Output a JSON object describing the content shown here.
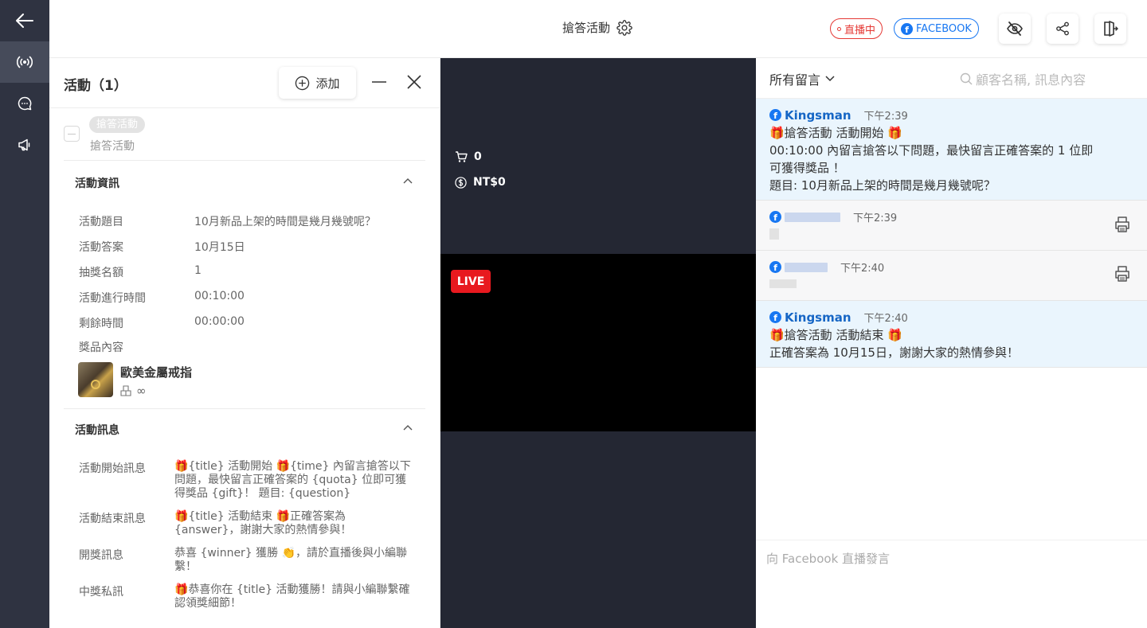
{
  "rail": {
    "items": [
      "back-icon",
      "broadcast-icon",
      "chat-icon",
      "megaphone-icon"
    ]
  },
  "topbar": {
    "title": "搶答活動",
    "live_status": "直播中",
    "platform": "FACEBOOK"
  },
  "panel": {
    "title": "活動（1）",
    "add_label": "添加",
    "activity": {
      "tag": "搶答活動",
      "name": "搶答活動"
    },
    "info_section": {
      "title": "活動資訊",
      "rows": [
        {
          "label": "活動題目",
          "value": "10月新品上架的時間是幾月幾號呢？"
        },
        {
          "label": "活動答案",
          "value": "10月15日"
        },
        {
          "label": "抽獎名額",
          "value": "1"
        },
        {
          "label": "活動進行時間",
          "value": "00:10:00"
        },
        {
          "label": "剩餘時間",
          "value": "00:00:00"
        }
      ],
      "prize_label": "獎品內容",
      "prize": {
        "name": "歐美金屬戒指",
        "stock": "∞"
      }
    },
    "message_section": {
      "title": "活動訊息",
      "rows": [
        {
          "label": "活動開始訊息",
          "value": "🎁{title} 活動開始 🎁{time} 內留言搶答以下問題，最快留言正確答案的 {quota} 位即可獲得獎品 {gift}！ 題目: {question}"
        },
        {
          "label": "活動結束訊息",
          "value": "🎁{title} 活動結束 🎁正確答案為 {answer}，謝謝大家的熱情參與！"
        },
        {
          "label": "開獎訊息",
          "value": "恭喜 {winner} 獲勝 👏，請於直播後與小編聯繫！"
        },
        {
          "label": "中獎私訊",
          "value": "🎁恭喜你在 {title} 活動獲勝！請與小編聯繫確認領獎細節！"
        }
      ]
    }
  },
  "video": {
    "cart_count": "0",
    "revenue": "NT$0",
    "live_label": "LIVE"
  },
  "comments": {
    "filter_label": "所有留言",
    "search_placeholder": "顧客名稱, 訊息內容",
    "items": [
      {
        "user": "Kingsman",
        "time": "下午2:39",
        "lines": [
          "🎁搶答活動 活動開始 🎁",
          "00:10:00 內留言搶答以下問題，最快留言正確答案的 1 位即",
          "可獲得獎品 ！",
          "題目: 10月新品上架的時間是幾月幾號呢？"
        ]
      },
      {
        "user": "",
        "time": "下午2:39"
      },
      {
        "user": "",
        "time": "下午2:40"
      },
      {
        "user": "Kingsman",
        "time": "下午2:40",
        "lines": [
          "🎁搶答活動 活動結束 🎁",
          "正確答案為 10月15日，謝謝大家的熱情參與！"
        ]
      }
    ],
    "compose_placeholder": "向 Facebook 直播發言"
  },
  "colors": {
    "rail_bg": "#2f3341",
    "live_red": "#e53935",
    "facebook_blue": "#1877f2",
    "highlight_bg": "#eaf5fd"
  }
}
